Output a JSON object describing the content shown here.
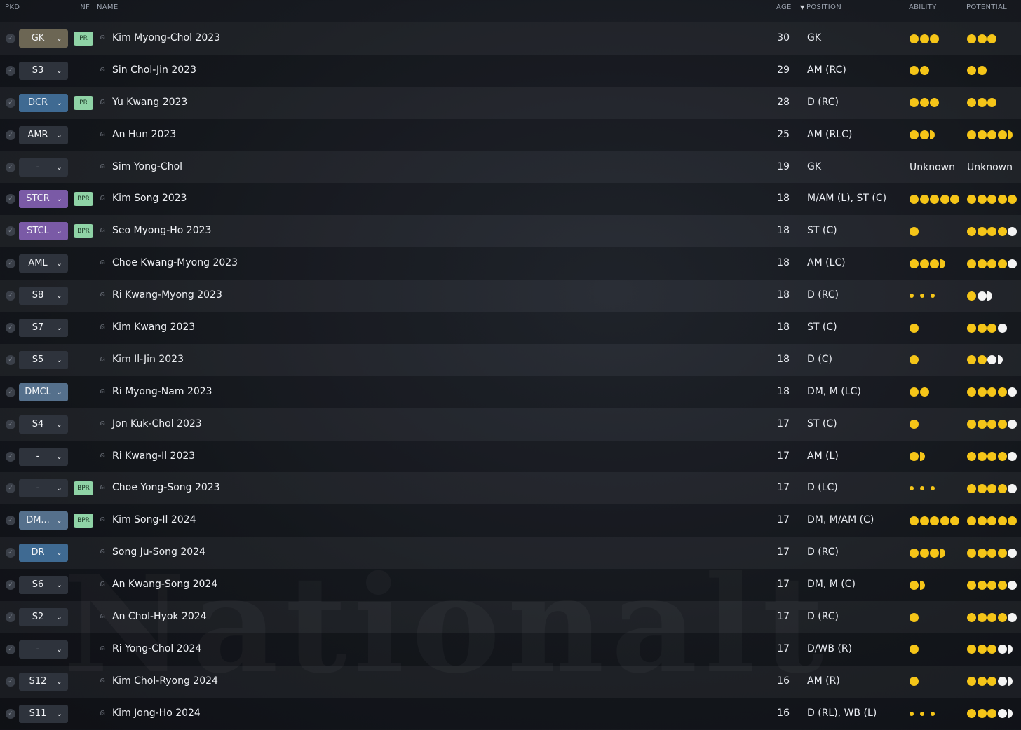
{
  "header": {
    "pkd": "PKD",
    "inf": "INF",
    "name": "NAME",
    "age": "AGE",
    "position": "POSITION",
    "ability": "ABILITY",
    "potential": "POTENTIAL",
    "sort_icon": "sort-desc-arrow-icon"
  },
  "watermark": "Nationalt",
  "colors": {
    "star_gold": "#f5c518",
    "star_white": "#f4f4f4",
    "inf_badge": "#8fd3a6",
    "pos_gk": "#6c6654",
    "pos_def": "#3f6a92",
    "pos_att": "#7a5aa6",
    "pos_mid": "#2e333c",
    "pos_dm": "#55708c"
  },
  "players": [
    {
      "pos": "GK",
      "pos_color": "#6c6654",
      "inf": "PR",
      "name": "Kim Myong-Chol 2023",
      "age": "30",
      "position": "GK",
      "ability": {
        "stars": 3
      },
      "potential": {
        "stars": 3
      }
    },
    {
      "pos": "S3",
      "pos_color": "#2e333c",
      "inf": "",
      "name": "Sin Chol-Jin 2023",
      "age": "29",
      "position": "AM (RC)",
      "ability": {
        "stars": 2
      },
      "potential": {
        "stars": 2
      }
    },
    {
      "pos": "DCR",
      "pos_color": "#3f6a92",
      "inf": "PR",
      "name": "Yu Kwang 2023",
      "age": "28",
      "position": "D (RC)",
      "ability": {
        "stars": 3
      },
      "potential": {
        "stars": 3
      }
    },
    {
      "pos": "AMR",
      "pos_color": "#2e333c",
      "inf": "",
      "name": "An Hun 2023",
      "age": "25",
      "position": "AM (RLC)",
      "ability": {
        "stars": 2.5
      },
      "potential": {
        "stars": 4.5
      }
    },
    {
      "pos": "-",
      "pos_color": "#2e333c",
      "inf": "",
      "name": "Sim Yong-Chol",
      "age": "19",
      "position": "GK",
      "ability": {
        "text": "Unknown"
      },
      "potential": {
        "text": "Unknown"
      }
    },
    {
      "pos": "STCR",
      "pos_color": "#7a5aa6",
      "inf": "BPR",
      "name": "Kim Song 2023",
      "age": "18",
      "position": "M/AM (L), ST (C)",
      "ability": {
        "stars": 5
      },
      "potential": {
        "stars": 5
      }
    },
    {
      "pos": "STCL",
      "pos_color": "#7a5aa6",
      "inf": "BPR",
      "name": "Seo Myong-Ho 2023",
      "age": "18",
      "position": "ST (C)",
      "ability": {
        "stars": 1
      },
      "potential": {
        "stars": 4,
        "range": 5
      }
    },
    {
      "pos": "AML",
      "pos_color": "#2e333c",
      "inf": "",
      "name": "Choe Kwang-Myong 2023",
      "age": "18",
      "position": "AM (LC)",
      "ability": {
        "stars": 3.5
      },
      "potential": {
        "stars": 4,
        "range": 5
      }
    },
    {
      "pos": "S8",
      "pos_color": "#2e333c",
      "inf": "",
      "name": "Ri Kwang-Myong 2023",
      "age": "18",
      "position": "D (RC)",
      "ability": {
        "dots": 3
      },
      "potential": {
        "stars": 1,
        "range": 2.5
      }
    },
    {
      "pos": "S7",
      "pos_color": "#2e333c",
      "inf": "",
      "name": "Kim Kwang 2023",
      "age": "18",
      "position": "ST (C)",
      "ability": {
        "stars": 1
      },
      "potential": {
        "stars": 3,
        "range": 4
      }
    },
    {
      "pos": "S5",
      "pos_color": "#2e333c",
      "inf": "",
      "name": "Kim Il-Jin 2023",
      "age": "18",
      "position": "D (C)",
      "ability": {
        "stars": 1
      },
      "potential": {
        "stars": 2,
        "range": 3.5
      }
    },
    {
      "pos": "DMCL",
      "pos_color": "#55708c",
      "inf": "",
      "name": "Ri Myong-Nam 2023",
      "age": "18",
      "position": "DM, M (LC)",
      "ability": {
        "stars": 2
      },
      "potential": {
        "stars": 4,
        "range": 5
      }
    },
    {
      "pos": "S4",
      "pos_color": "#2e333c",
      "inf": "",
      "name": "Jon Kuk-Chol 2023",
      "age": "17",
      "position": "ST (C)",
      "ability": {
        "stars": 1
      },
      "potential": {
        "stars": 4,
        "range": 5
      }
    },
    {
      "pos": "-",
      "pos_color": "#2e333c",
      "inf": "",
      "name": "Ri Kwang-Il 2023",
      "age": "17",
      "position": "AM (L)",
      "ability": {
        "stars": 1.5
      },
      "potential": {
        "stars": 4,
        "range": 5
      }
    },
    {
      "pos": "-",
      "pos_color": "#2e333c",
      "inf": "BPR",
      "name": "Choe Yong-Song 2023",
      "age": "17",
      "position": "D (LC)",
      "ability": {
        "dots": 3
      },
      "potential": {
        "stars": 4,
        "range": 5
      }
    },
    {
      "pos": "DM...",
      "pos_color": "#55708c",
      "inf": "BPR",
      "name": "Kim Song-Il 2024",
      "age": "17",
      "position": "DM, M/AM (C)",
      "ability": {
        "stars": 5
      },
      "potential": {
        "stars": 5
      }
    },
    {
      "pos": "DR",
      "pos_color": "#3f6a92",
      "inf": "",
      "name": "Song Ju-Song 2024",
      "age": "17",
      "position": "D (RC)",
      "ability": {
        "stars": 3.5
      },
      "potential": {
        "stars": 4,
        "range": 5
      }
    },
    {
      "pos": "S6",
      "pos_color": "#2e333c",
      "inf": "",
      "name": "An Kwang-Song 2024",
      "age": "17",
      "position": "DM, M (C)",
      "ability": {
        "stars": 1.5
      },
      "potential": {
        "stars": 4,
        "range": 5
      }
    },
    {
      "pos": "S2",
      "pos_color": "#2e333c",
      "inf": "",
      "name": "An Chol-Hyok 2024",
      "age": "17",
      "position": "D (RC)",
      "ability": {
        "stars": 1
      },
      "potential": {
        "stars": 4,
        "range": 5
      }
    },
    {
      "pos": "-",
      "pos_color": "#2e333c",
      "inf": "",
      "name": "Ri Yong-Chol 2024",
      "age": "17",
      "position": "D/WB (R)",
      "ability": {
        "stars": 1
      },
      "potential": {
        "stars": 3,
        "range": 4.5
      }
    },
    {
      "pos": "S12",
      "pos_color": "#2e333c",
      "inf": "",
      "name": "Kim Chol-Ryong 2024",
      "age": "16",
      "position": "AM (R)",
      "ability": {
        "stars": 1
      },
      "potential": {
        "stars": 3,
        "range": 4.5
      }
    },
    {
      "pos": "S11",
      "pos_color": "#2e333c",
      "inf": "",
      "name": "Kim Jong-Ho 2024",
      "age": "16",
      "position": "D (RL), WB (L)",
      "ability": {
        "dots": 3
      },
      "potential": {
        "stars": 3,
        "range": 4.5
      }
    }
  ]
}
